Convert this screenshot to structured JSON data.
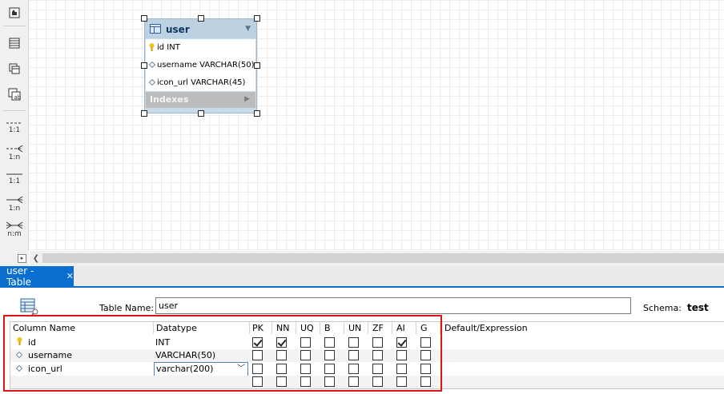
{
  "entity": {
    "title": "user",
    "columns": [
      {
        "icon": "primary-key-icon",
        "label": "id INT"
      },
      {
        "icon": "column-diamond-icon",
        "label": "username VARCHAR(50)"
      },
      {
        "icon": "column-diamond-icon",
        "label": "icon_url VARCHAR(45)"
      }
    ],
    "indexes_label": "Indexes"
  },
  "toolbar": {
    "relations": [
      {
        "label": "1:1"
      },
      {
        "label": "1:n"
      },
      {
        "label": "1:1"
      },
      {
        "label": "1:n"
      },
      {
        "label": "n:m"
      }
    ]
  },
  "editor": {
    "tab_label": "user - Table",
    "tab_close": "✕",
    "table_name_label": "Table Name:",
    "table_name_value": "user",
    "schema_label": "Schema:",
    "schema_value": "test",
    "headers": {
      "column_name": "Column Name",
      "datatype": "Datatype",
      "flags": [
        "PK",
        "NN",
        "UQ",
        "B",
        "UN",
        "ZF",
        "AI",
        "G"
      ],
      "default": "Default/Expression"
    },
    "rows": [
      {
        "icon": "primary-key-icon",
        "name": "id",
        "datatype": "INT",
        "flags": [
          true,
          true,
          false,
          false,
          false,
          false,
          true,
          false
        ]
      },
      {
        "icon": "column-diamond-icon",
        "name": "username",
        "datatype": "VARCHAR(50)",
        "flags": [
          false,
          false,
          false,
          false,
          false,
          false,
          false,
          false
        ]
      },
      {
        "icon": "column-diamond-icon",
        "name": "icon_url",
        "datatype": "varchar(200)",
        "flags": [
          false,
          false,
          false,
          false,
          false,
          false,
          false,
          false
        ],
        "editing": true
      },
      {
        "icon": "",
        "name": "",
        "datatype": "",
        "flags": [
          false,
          false,
          false,
          false,
          false,
          false,
          false,
          false
        ]
      }
    ]
  },
  "colors": {
    "accent": "#0a6ecf",
    "highlight": "#e01414",
    "entity_header": "#bcd2e3"
  }
}
